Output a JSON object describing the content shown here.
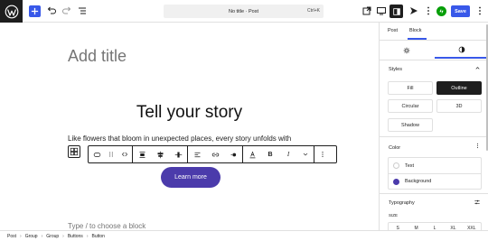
{
  "topbar": {
    "logo_icon": "wordpress-logo-icon",
    "document_title": "No title · Post",
    "document_shortcut": "Ctrl+K",
    "save_label": "Save",
    "accent_color": "#3858e9"
  },
  "editor": {
    "title_placeholder": "Add title",
    "heading": "Tell your story",
    "paragraph": "Like flowers that bloom in unexpected places, every story unfolds with",
    "button_text": "Learn more",
    "button_color": "#4b3bab",
    "appender_placeholder": "Type / to choose a block"
  },
  "sidebar": {
    "tabs": [
      "Post",
      "Block"
    ],
    "active_tab": "Block",
    "styles": {
      "title": "Styles",
      "options": [
        "Fill",
        "Outline",
        "Circular",
        "3D",
        "Shadow"
      ],
      "selected": "Outline"
    },
    "color": {
      "title": "Color",
      "items": [
        "Text",
        "Background"
      ]
    },
    "typography": {
      "title": "Typography",
      "size_label": "SIZE",
      "sizes": [
        "S",
        "M",
        "L",
        "XL",
        "XXL"
      ]
    }
  },
  "breadcrumb": [
    "Post",
    "Group",
    "Group",
    "Buttons",
    "Button"
  ]
}
